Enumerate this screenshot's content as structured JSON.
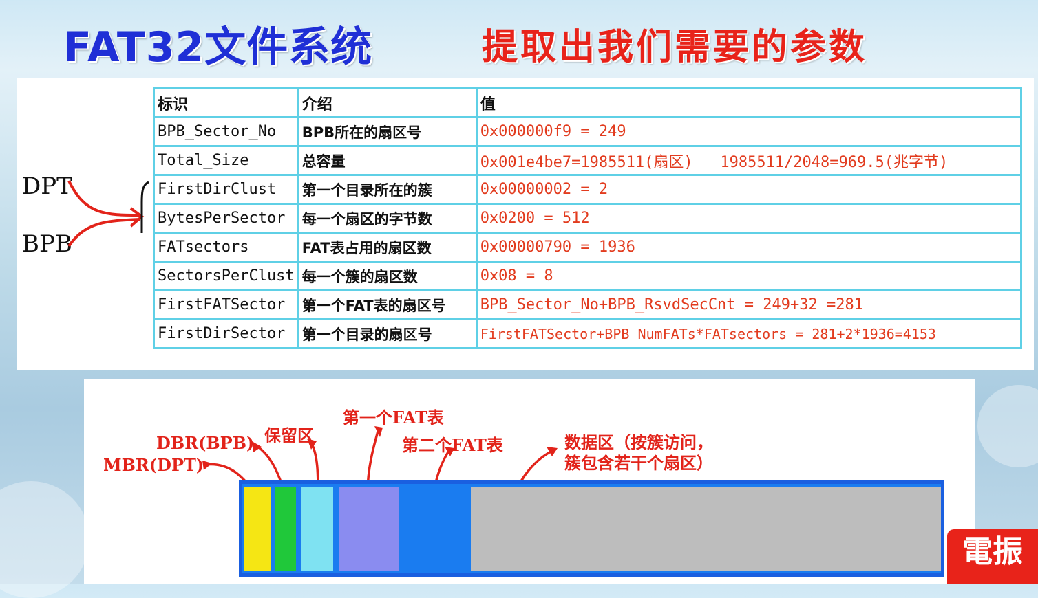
{
  "title": {
    "left": "FAT32文件系统",
    "right": "提取出我们需要的参数"
  },
  "side_labels": {
    "dpt": "DPT",
    "bpb": "BPB"
  },
  "table": {
    "headers": [
      "标识",
      "介绍",
      "值"
    ],
    "rows": [
      [
        "BPB_Sector_No",
        "BPB所在的扇区号",
        "0x000000f9 = 249"
      ],
      [
        "Total_Size",
        "总容量",
        "0x001e4be7=1985511(扇区)   1985511/2048=969.5(兆字节)"
      ],
      [
        "FirstDirClust",
        "第一个目录所在的簇",
        "0x00000002 = 2"
      ],
      [
        "BytesPerSector",
        "每一个扇区的字节数",
        "0x0200 = 512"
      ],
      [
        "FATsectors",
        "FAT表占用的扇区数",
        "0x00000790 = 1936"
      ],
      [
        "SectorsPerClust",
        "每一个簇的扇区数",
        "0x08 = 8"
      ],
      [
        "FirstFATSector",
        "第一个FAT表的扇区号",
        "BPB_Sector_No+BPB_RsvdSecCnt = 249+32 =281"
      ],
      [
        "FirstDirSector",
        "第一个目录的扇区号",
        "FirstFATSector+BPB_NumFATs*FATsectors = 281+2*1936=4153"
      ]
    ]
  },
  "diagram": {
    "labels": {
      "mbr": "MBR(DPT)",
      "dbr": "DBR(BPB)",
      "reserved": "保留区",
      "fat1": "第一个FAT表",
      "fat2": "第二个FAT表",
      "data_line1": "数据区（按簇访问，",
      "data_line2": "簇包含若干个扇区）"
    },
    "colors": {
      "mbr": "#f5e614",
      "dbr": "#20c83a",
      "reserved": "#7fe2f2",
      "fat1": "#8a8cf0",
      "fat2": "#1a7cf0",
      "data": "#bdbdbd"
    }
  },
  "logo": {
    "text": "電振"
  }
}
